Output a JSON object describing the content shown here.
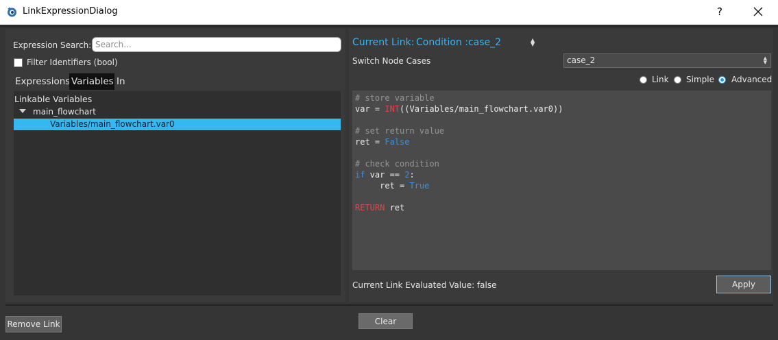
{
  "window": {
    "title": "LinkExpressionDialog",
    "help_label": "?"
  },
  "left": {
    "search_label": "Expression Search:",
    "search_placeholder": "Search...",
    "search_value": "",
    "filter_label": "Filter Identifiers  (bool)",
    "filter_checked": false,
    "tabs": [
      {
        "label": "Expressions",
        "active": false
      },
      {
        "label": "Variables",
        "active": true
      },
      {
        "label": "In",
        "active": false
      }
    ],
    "tree": {
      "header": "Linkable Variables",
      "parent": "main_flowchart",
      "selected_child": "Variables/main_flowchart.var0"
    }
  },
  "right": {
    "current_link_label": "Current Link:",
    "current_link_value": "Condition :case_2",
    "switch_label": "Switch Node Cases",
    "switch_value": "case_2",
    "modes": [
      {
        "label": "Link",
        "checked": false
      },
      {
        "label": "Simple",
        "checked": false
      },
      {
        "label": "Advanced",
        "checked": true
      }
    ],
    "code": {
      "comment1": "# store variable",
      "line1_a": "var = ",
      "line1_kw": "INT",
      "line1_b": "((Variables/main_flowchart.var0))",
      "comment2": "# set return value",
      "line2_a": "ret = ",
      "line2_val": "False",
      "comment3": "# check condition",
      "line3_kw": "if",
      "line3_a": " var == ",
      "line3_num": "2",
      "line3_b": ":",
      "line4_a": "     ret = ",
      "line4_val": "True",
      "line5_kw": "RETURN",
      "line5_a": " ret"
    },
    "clear_label": "Clear",
    "evaluated_text": "Current Link Evaluated Value: false",
    "apply_label": "Apply"
  },
  "footer": {
    "remove_label": "Remove Link"
  },
  "colors": {
    "accent": "#39b3f2",
    "selection": "#35b7f2",
    "keyword": "#d44a4a",
    "literal": "#3d8fe0"
  }
}
